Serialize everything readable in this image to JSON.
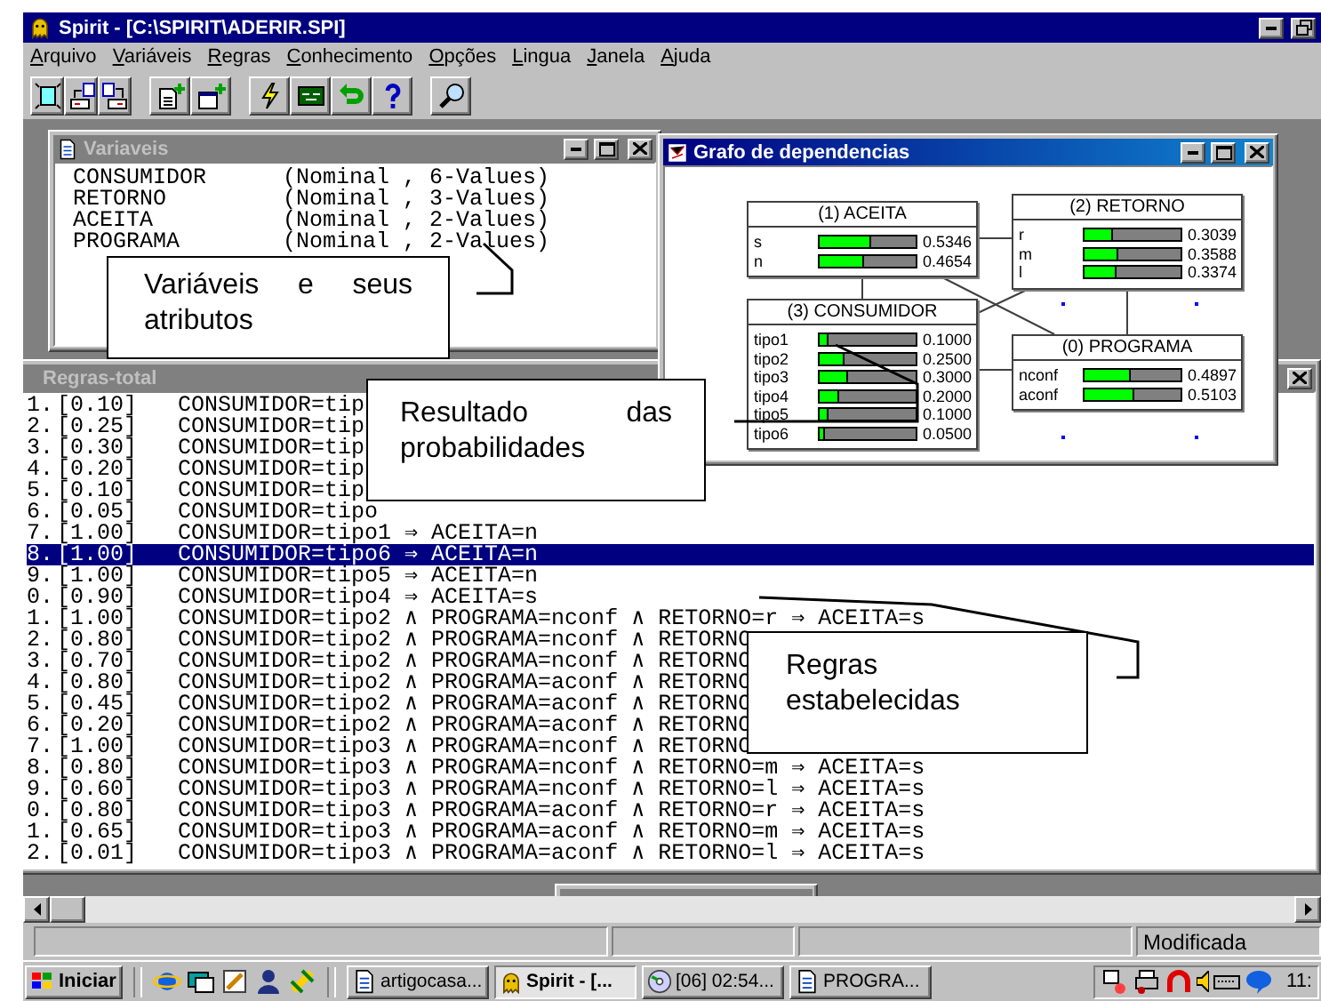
{
  "window": {
    "title": "Spirit - [C:\\SPIRIT\\ADERIR.SPI]"
  },
  "menu": [
    "Arquivo",
    "Variáveis",
    "Regras",
    "Conhecimento",
    "Opções",
    "Lingua",
    "Janela",
    "Ajuda"
  ],
  "variables_window": {
    "title": "Variaveis",
    "active": false,
    "variables": [
      {
        "name": "CONSUMIDOR",
        "type": "(Nominal , 6-Values)"
      },
      {
        "name": "RETORNO",
        "type": "(Nominal , 3-Values)"
      },
      {
        "name": "ACEITA",
        "type": "(Nominal , 2-Values)"
      },
      {
        "name": "PROGRAMA",
        "type": "(Nominal , 2-Values)"
      }
    ]
  },
  "graph_window": {
    "title": "Grafo de dependencias",
    "active": true,
    "nodes": [
      {
        "title": "(1) ACEITA",
        "states": [
          {
            "label": "s",
            "level": 0.5346,
            "value": "0.5346"
          },
          {
            "label": "n",
            "level": 0.4654,
            "value": "0.4654"
          }
        ]
      },
      {
        "title": "(2) RETORNO",
        "states": [
          {
            "label": "r",
            "level": 0.3039,
            "value": "0.3039"
          },
          {
            "label": "m",
            "level": 0.3588,
            "value": "0.3588"
          },
          {
            "label": "l",
            "level": 0.3374,
            "value": "0.3374"
          }
        ]
      },
      {
        "title": "(3) CONSUMIDOR",
        "states": [
          {
            "label": "tipo1",
            "level": 0.1,
            "value": "0.1000"
          },
          {
            "label": "tipo2",
            "level": 0.25,
            "value": "0.2500"
          },
          {
            "label": "tipo3",
            "level": 0.3,
            "value": "0.3000"
          },
          {
            "label": "tipo4",
            "level": 0.2,
            "value": "0.2000"
          },
          {
            "label": "tipo5",
            "level": 0.1,
            "value": "0.1000"
          },
          {
            "label": "tipo6",
            "level": 0.05,
            "value": "0.0500"
          }
        ]
      },
      {
        "title": "(0) PROGRAMA",
        "states": [
          {
            "label": "nconf",
            "level": 0.4897,
            "value": "0.4897"
          },
          {
            "label": "aconf",
            "level": 0.5103,
            "value": "0.5103"
          }
        ]
      }
    ]
  },
  "rules_window": {
    "title": "Regras-total",
    "active": false,
    "rules": [
      {
        "number": "1.",
        "weight": "[0.10]",
        "rule": "CONSUMIDOR=tip",
        "selected": false
      },
      {
        "number": "2.",
        "weight": "[0.25]",
        "rule": "CONSUMIDOR=tip",
        "selected": false
      },
      {
        "number": "3.",
        "weight": "[0.30]",
        "rule": "CONSUMIDOR=tip",
        "selected": false
      },
      {
        "number": "4.",
        "weight": "[0.20]",
        "rule": "CONSUMIDOR=tip",
        "selected": false
      },
      {
        "number": "5.",
        "weight": "[0.10]",
        "rule": "CONSUMIDOR=tip",
        "selected": false
      },
      {
        "number": "6.",
        "weight": "[0.05]",
        "rule": "CONSUMIDOR=tipo",
        "selected": false
      },
      {
        "number": "7.",
        "weight": "[1.00]",
        "rule": "CONSUMIDOR=tipo1 ⇒ ACEITA=n",
        "selected": false
      },
      {
        "number": "8.",
        "weight": "[1.00]",
        "rule": "CONSUMIDOR=tipo6 ⇒ ACEITA=n",
        "selected": true
      },
      {
        "number": "9.",
        "weight": "[1.00]",
        "rule": "CONSUMIDOR=tipo5 ⇒ ACEITA=n",
        "selected": false
      },
      {
        "number": "0.",
        "weight": "[0.90]",
        "rule": "CONSUMIDOR=tipo4 ⇒ ACEITA=s",
        "selected": false
      },
      {
        "number": "1.",
        "weight": "[1.00]",
        "rule": "CONSUMIDOR=tipo2 ∧ PROGRAMA=nconf ∧ RETORNO=r ⇒ ACEITA=s",
        "selected": false
      },
      {
        "number": "2.",
        "weight": "[0.80]",
        "rule": "CONSUMIDOR=tipo2 ∧ PROGRAMA=nconf ∧ RETORNO",
        "selected": false
      },
      {
        "number": "3.",
        "weight": "[0.70]",
        "rule": "CONSUMIDOR=tipo2 ∧ PROGRAMA=nconf ∧ RETORNO",
        "selected": false
      },
      {
        "number": "4.",
        "weight": "[0.80]",
        "rule": "CONSUMIDOR=tipo2 ∧ PROGRAMA=aconf ∧ RETORNO",
        "selected": false
      },
      {
        "number": "5.",
        "weight": "[0.45]",
        "rule": "CONSUMIDOR=tipo2 ∧ PROGRAMA=aconf ∧ RETORNO",
        "selected": false
      },
      {
        "number": "6.",
        "weight": "[0.20]",
        "rule": "CONSUMIDOR=tipo2 ∧ PROGRAMA=aconf ∧ RETORNO",
        "selected": false
      },
      {
        "number": "7.",
        "weight": "[1.00]",
        "rule": "CONSUMIDOR=tipo3 ∧ PROGRAMA=nconf ∧ RETORNO",
        "selected": false
      },
      {
        "number": "8.",
        "weight": "[0.80]",
        "rule": "CONSUMIDOR=tipo3 ∧ PROGRAMA=nconf ∧ RETORNO=m ⇒ ACEITA=s",
        "selected": false
      },
      {
        "number": "9.",
        "weight": "[0.60]",
        "rule": "CONSUMIDOR=tipo3 ∧ PROGRAMA=nconf ∧ RETORNO=l ⇒ ACEITA=s",
        "selected": false
      },
      {
        "number": "0.",
        "weight": "[0.80]",
        "rule": "CONSUMIDOR=tipo3 ∧ PROGRAMA=aconf ∧ RETORNO=r ⇒ ACEITA=s",
        "selected": false
      },
      {
        "number": "1.",
        "weight": "[0.65]",
        "rule": "CONSUMIDOR=tipo3 ∧ PROGRAMA=aconf ∧ RETORNO=m ⇒ ACEITA=s",
        "selected": false
      },
      {
        "number": "2.",
        "weight": "[0.01]",
        "rule": "CONSUMIDOR=tipo3 ∧ PROGRAMA=aconf ∧ RETORNO=l ⇒ ACEITA=s",
        "selected": false
      }
    ]
  },
  "callouts": [
    {
      "text": "Variáveis e seus atributos"
    },
    {
      "text": "Resultado das probabilidades"
    },
    {
      "text": "Regras estabelecidas"
    }
  ],
  "status_bar": {
    "state": "Modificada"
  },
  "taskbar": {
    "start": "Iniciar",
    "tasks": [
      {
        "label": "artigocasa...",
        "kind": "document",
        "selected": false
      },
      {
        "label": "Spirit - [...",
        "kind": "app",
        "selected": true
      },
      {
        "label": "[06] 02:54...",
        "kind": "disc",
        "selected": false
      },
      {
        "label": "PROGRA...",
        "kind": "document",
        "selected": false
      }
    ],
    "clock": "11:"
  }
}
